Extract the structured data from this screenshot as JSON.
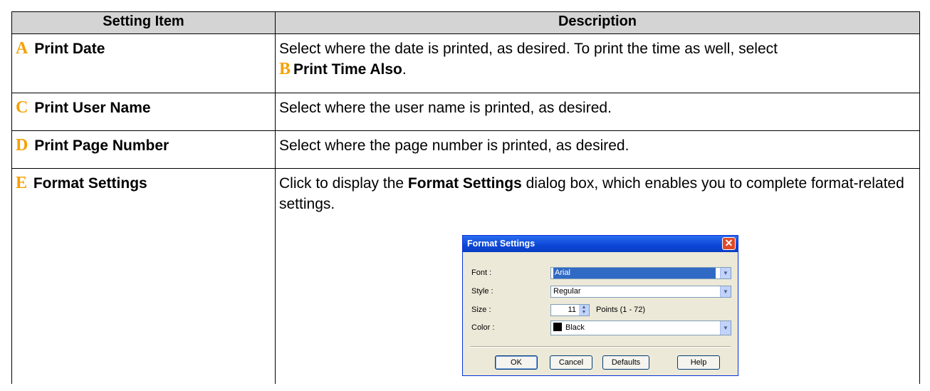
{
  "table": {
    "headers": {
      "item": "Setting Item",
      "description": "Description"
    },
    "rows": [
      {
        "letter": "A",
        "item": "Print Date",
        "desc_text": "Select where the date is printed, as desired. To print the time as well, select",
        "inline_letter": "B",
        "inline_bold": "Print Time Also",
        "desc_end": "."
      },
      {
        "letter": "C",
        "item": "Print User Name",
        "desc_text": "Select where the user name is printed, as desired."
      },
      {
        "letter": "D",
        "item": "Print Page Number",
        "desc_text": "Select where the page number is printed, as desired."
      },
      {
        "letter": "E",
        "item": "Format Settings",
        "desc_pre": "Click to display the",
        "desc_bold": "Format Settings",
        "desc_post": "dialog box, which enables you to complete format-related settings."
      }
    ]
  },
  "dialog": {
    "title": "Format Settings",
    "close_glyph": "✕",
    "font_label": "Font :",
    "font_value": "Arial",
    "style_label": "Style :",
    "style_value": "Regular",
    "size_label": "Size :",
    "size_value": "11",
    "size_range": "Points (1 - 72)",
    "color_label": "Color :",
    "color_value": "Black",
    "swatch_color": "#000000",
    "buttons": {
      "ok": "OK",
      "cancel": "Cancel",
      "defaults": "Defaults",
      "help": "Help"
    }
  }
}
